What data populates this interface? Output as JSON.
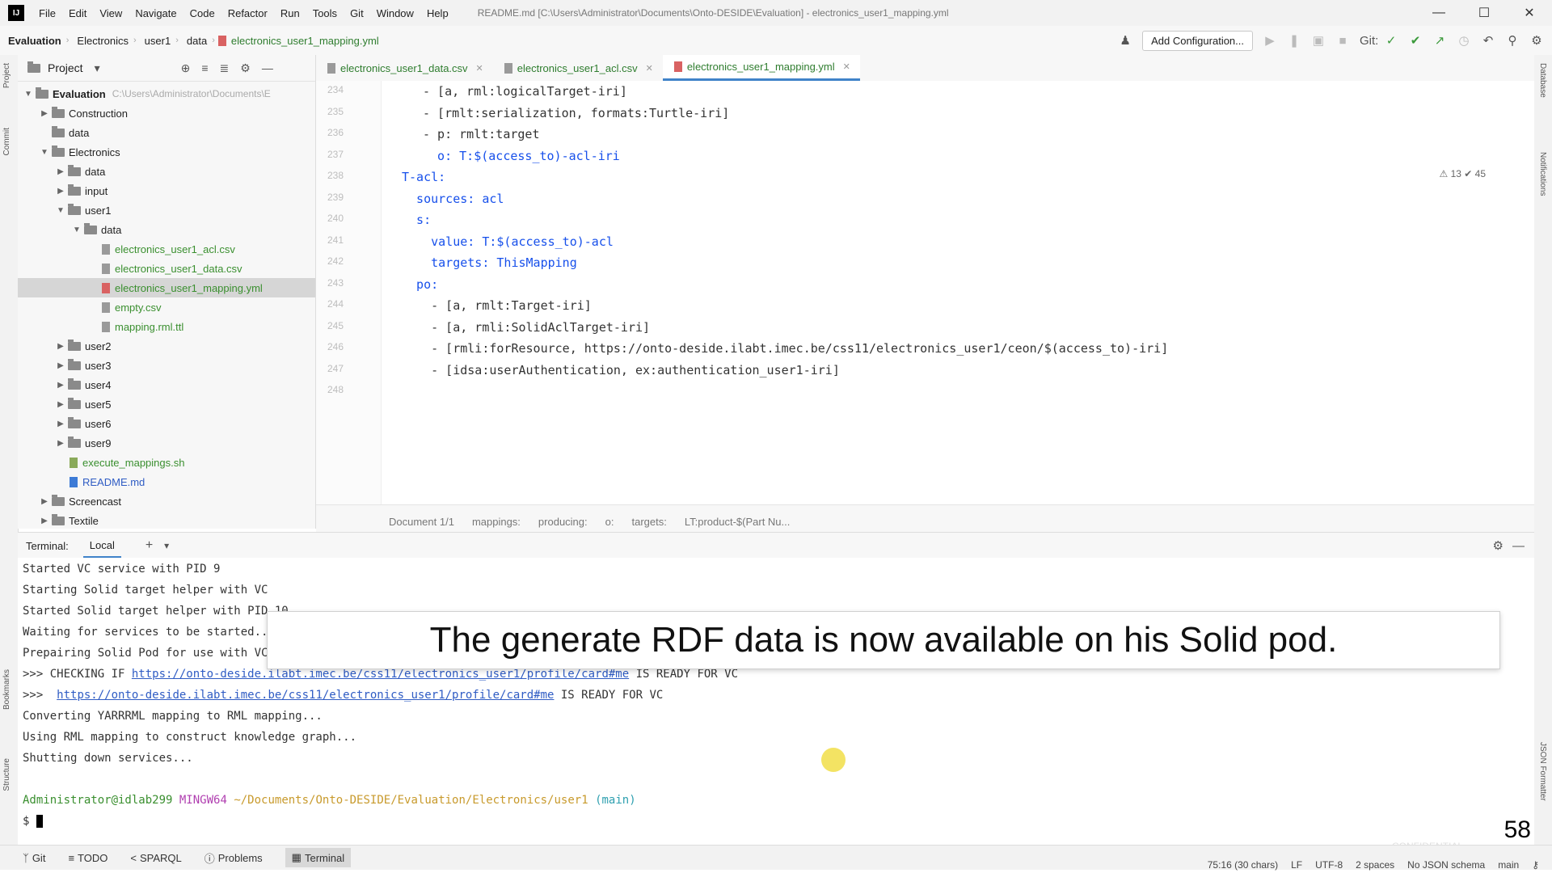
{
  "titlebar": {
    "menus": [
      "File",
      "Edit",
      "View",
      "Navigate",
      "Code",
      "Refactor",
      "Run",
      "Tools",
      "Git",
      "Window",
      "Help"
    ],
    "window_title": "README.md [C:\\Users\\Administrator\\Documents\\Onto-DESIDE\\Evaluation] - electronics_user1_mapping.yml"
  },
  "navbar": {
    "crumbs": [
      "Evaluation",
      "Electronics",
      "user1",
      "data",
      "electronics_user1_mapping.yml"
    ],
    "add_config": "Add Configuration...",
    "git_label": "Git:"
  },
  "project": {
    "title": "Project",
    "root": "Evaluation",
    "root_hint": "C:\\Users\\Administrator\\Documents\\E",
    "items": [
      {
        "label": "Construction",
        "kind": "folder"
      },
      {
        "label": "data",
        "kind": "folder"
      },
      {
        "label": "Electronics",
        "kind": "folder"
      },
      {
        "label": "data",
        "kind": "folder"
      },
      {
        "label": "input",
        "kind": "folder"
      },
      {
        "label": "user1",
        "kind": "folder"
      },
      {
        "label": "data",
        "kind": "folder"
      },
      {
        "label": "electronics_user1_acl.csv",
        "kind": "file"
      },
      {
        "label": "electronics_user1_data.csv",
        "kind": "file"
      },
      {
        "label": "electronics_user1_mapping.yml",
        "kind": "yml"
      },
      {
        "label": "empty.csv",
        "kind": "file"
      },
      {
        "label": "mapping.rml.ttl",
        "kind": "file"
      },
      {
        "label": "user2",
        "kind": "folder"
      },
      {
        "label": "user3",
        "kind": "folder"
      },
      {
        "label": "user4",
        "kind": "folder"
      },
      {
        "label": "user5",
        "kind": "folder"
      },
      {
        "label": "user6",
        "kind": "folder"
      },
      {
        "label": "user9",
        "kind": "folder"
      },
      {
        "label": "execute_mappings.sh",
        "kind": "sh"
      },
      {
        "label": "README.md",
        "kind": "md"
      },
      {
        "label": "Screencast",
        "kind": "folder"
      },
      {
        "label": "Textile",
        "kind": "folder"
      }
    ]
  },
  "editor": {
    "tabs": [
      "electronics_user1_data.csv",
      "electronics_user1_acl.csv",
      "electronics_user1_mapping.yml"
    ],
    "inspection": "⚠ 13  ✔ 45",
    "lines": [
      {
        "n": "234",
        "text": "- [a, rml:logicalTarget-iri]"
      },
      {
        "n": "235",
        "text": "- [rmlt:serialization, formats:Turtle-iri]"
      },
      {
        "n": "236",
        "text": "- p: rmlt:target"
      },
      {
        "n": "237",
        "text": "  o: T:$(access_to)-acl-iri"
      },
      {
        "n": "238",
        "text": "T-acl:"
      },
      {
        "n": "239",
        "text": "  sources: acl"
      },
      {
        "n": "240",
        "text": "  s:"
      },
      {
        "n": "241",
        "text": "    value: T:$(access_to)-acl"
      },
      {
        "n": "242",
        "text": "    targets: ThisMapping"
      },
      {
        "n": "243",
        "text": "  po:"
      },
      {
        "n": "244",
        "text": "    - [a, rmlt:Target-iri]"
      },
      {
        "n": "245",
        "text": "    - [a, rmli:SolidAclTarget-iri]"
      },
      {
        "n": "246",
        "text": "    - [rmli:forResource, https://onto-deside.ilabt.imec.be/css11/electronics_user1/ceon/$(access_to)-iri]"
      },
      {
        "n": "247",
        "text": "    - [idsa:userAuthentication, ex:authentication_user1-iri]"
      },
      {
        "n": "248",
        "text": ""
      }
    ],
    "breadcrumbs": [
      "Document 1/1",
      "mappings:",
      "producing:",
      "o:",
      "targets:",
      "LT:product-$(Part Nu..."
    ]
  },
  "terminal": {
    "title": "Terminal:",
    "tab": "Local",
    "lines": [
      "Started VC service with PID 9",
      "Starting Solid target helper with VC",
      "Started Solid target helper with PID 10",
      "Waiting for services to be started...",
      "Prepairing Solid Pod for use with VC..."
    ],
    "check1_prefix": ">>> CHECKING IF ",
    "check1_url": "https://onto-deside.ilabt.imec.be/css11/electronics_user1/profile/card#me",
    "check1_suffix": " IS READY FOR VC",
    "check2_prefix": ">>>  ",
    "check2_url": "https://onto-deside.ilabt.imec.be/css11/electronics_user1/profile/card#me",
    "check2_suffix": " IS READY FOR VC",
    "after": [
      "Converting YARRRML mapping to RML mapping...",
      "Using RML mapping to construct knowledge graph...",
      "Shutting down services..."
    ],
    "prompt_user": "Administrator@idlab299",
    "prompt_host": "MINGW64",
    "prompt_path": "~/Documents/Onto-DESIDE/Evaluation/Electronics/user1",
    "prompt_branch": "(main)",
    "prompt_symbol": "$"
  },
  "subtitle": "The generate RDF data is now available on his Solid pod.",
  "slide_number": "58",
  "watermark": "CONFIDENTIAL",
  "toolbar": {
    "git": "Git",
    "todo": "TODO",
    "sparql": "SPARQL",
    "problems": "Problems",
    "terminal": "Terminal"
  },
  "status": [
    "75:16 (30 chars)",
    "LF",
    "UTF-8",
    "2 spaces",
    "No JSON schema",
    "main"
  ],
  "stripes": {
    "project": "Project",
    "commit": "Commit",
    "bookmarks": "Bookmarks",
    "structure": "Structure",
    "database": "Database",
    "notifications": "Notifications",
    "json": "JSON Formatter"
  }
}
